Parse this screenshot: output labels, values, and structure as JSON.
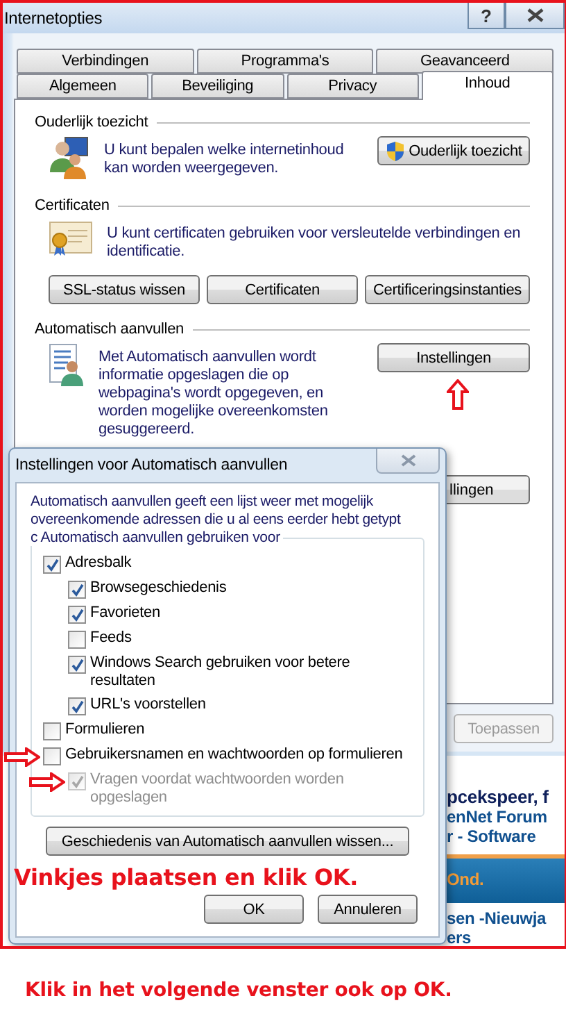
{
  "window": {
    "title": "Internetopties",
    "help_button": "?"
  },
  "tab_rows": [
    {
      "tabs": [
        {
          "label": "Verbindingen",
          "selected": false
        },
        {
          "label": "Programma's",
          "selected": false
        },
        {
          "label": "Geavanceerd",
          "selected": false
        }
      ]
    },
    {
      "tabs": [
        {
          "label": "Algemeen",
          "selected": false
        },
        {
          "label": "Beveiliging",
          "selected": false
        },
        {
          "label": "Privacy",
          "selected": false
        },
        {
          "label": "Inhoud",
          "selected": true
        }
      ]
    }
  ],
  "sections": [
    {
      "kind": "parental",
      "title": "Ouderlijk toezicht",
      "description": "U kunt bepalen welke internetinhoud kan worden weergegeven.",
      "buttons": [
        {
          "label": "Ouderlijk toezicht",
          "shield": true
        }
      ]
    },
    {
      "kind": "certificates",
      "title": "Certificaten",
      "description": "U kunt certificaten gebruiken voor versleutelde verbindingen en identificatie.",
      "buttons": [
        {
          "label": "SSL-status wissen"
        },
        {
          "label": "Certificaten"
        },
        {
          "label": "Certificeringsinstanties"
        }
      ]
    },
    {
      "kind": "autocomplete",
      "title": "Automatisch aanvullen",
      "description": "Met Automatisch aanvullen wordt informatie opgeslagen die op webpagina's wordt opgegeven, en worden mogelijke overeenkomsten gesuggereerd.",
      "buttons": [
        {
          "label": "Instellingen",
          "arrow": true
        }
      ]
    }
  ],
  "partial_button": "llingen",
  "apply_button": {
    "label": "Toepassen",
    "disabled": true
  },
  "background_page": [
    {
      "kind": "headline",
      "text": "pcekspeer, f"
    },
    {
      "kind": "link",
      "text": "enNet Forum"
    },
    {
      "kind": "link",
      "text": "r - Software"
    },
    {
      "kind": "banner",
      "text": "Ond."
    },
    {
      "kind": "link",
      "text": "sen -Nieuwja"
    },
    {
      "kind": "link",
      "text": "ers"
    }
  ],
  "dialog": {
    "title": "Instellingen voor Automatisch aanvullen",
    "intro": "Automatisch aanvullen geeft een lijst weer met mogelijk overeenkomende adressen die u al eens eerder hebt getypt",
    "group_label": "c Automatisch aanvullen gebruiken voor",
    "options": [
      {
        "label": "Adresbalk",
        "checked": true,
        "disabled": false,
        "children": [
          {
            "label": "Browsegeschiedenis",
            "checked": true,
            "disabled": false
          },
          {
            "label": "Favorieten",
            "checked": true,
            "disabled": false
          },
          {
            "label": "Feeds",
            "checked": false,
            "disabled": false
          },
          {
            "label": "Windows Search gebruiken voor betere resultaten",
            "checked": true,
            "disabled": false
          },
          {
            "label": "URL's voorstellen",
            "checked": true,
            "disabled": false
          }
        ]
      },
      {
        "label": "Formulieren",
        "checked": false,
        "disabled": false
      },
      {
        "label": "Gebruikersnamen en wachtwoorden op formulieren",
        "checked": false,
        "disabled": false,
        "arrow": true,
        "children": [
          {
            "label": "Vragen voordat wachtwoorden worden opgeslagen",
            "checked": true,
            "disabled": true,
            "arrow": true
          }
        ]
      }
    ],
    "clear_button": "Geschiedenis van Automatisch aanvullen wissen...",
    "note": "Vinkjes plaatsen en klik OK.",
    "buttons": [
      "OK",
      "Annuleren"
    ]
  },
  "footer_note": "Klik in het volgende venster ook op OK."
}
